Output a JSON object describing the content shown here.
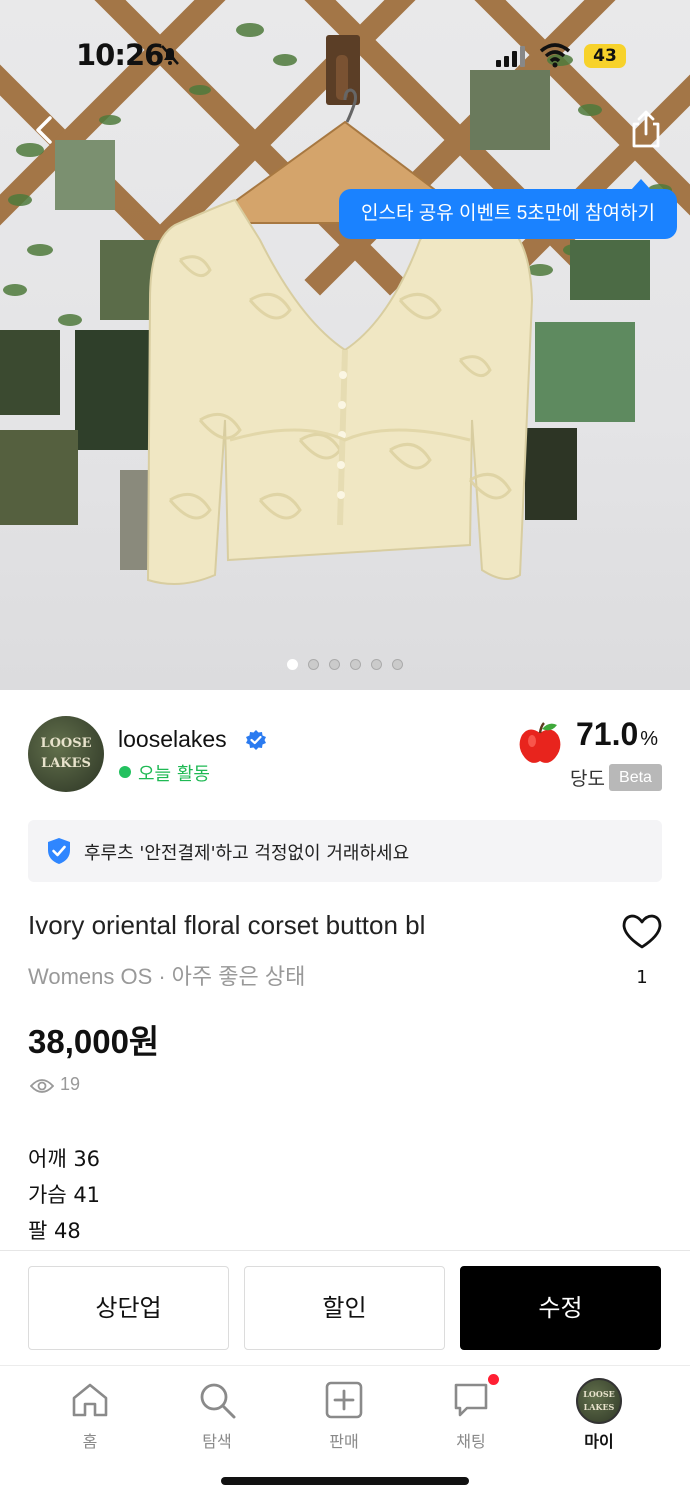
{
  "status_bar": {
    "time": "10:26",
    "battery": "43"
  },
  "hero": {
    "insta_event": "인스타 공유 이벤트 5초만에 참여하기",
    "image_count": 6,
    "active_index": 0
  },
  "seller": {
    "avatar_text_1": "LOOSE",
    "avatar_text_2": "LAKES",
    "name": "looselakes",
    "activity": "오늘 활동",
    "score": "71.0",
    "score_unit": "%",
    "score_label": "당도",
    "beta": "Beta"
  },
  "safety_banner": "후루츠 '안전결제'하고 걱정없이 거래하세요",
  "product": {
    "title": "Ivory oriental floral corset button bl",
    "size": "Womens OS",
    "separator": "·",
    "condition": "아주 좋은 상태",
    "price": "38,000원",
    "views": "19",
    "likes": "1",
    "description": [
      "어깨 36",
      "가슴 41",
      "팔 48"
    ]
  },
  "actions": {
    "bump": "상단업",
    "discount": "할인",
    "edit": "수정"
  },
  "tabs": [
    {
      "label": "홈",
      "icon": "home-icon"
    },
    {
      "label": "탐색",
      "icon": "search-icon"
    },
    {
      "label": "판매",
      "icon": "add-square-icon"
    },
    {
      "label": "채팅",
      "icon": "chat-icon"
    },
    {
      "label": "마이",
      "icon": "profile-avatar"
    }
  ],
  "colors": {
    "accent_blue": "#1a82ff",
    "active_green": "#1fb954",
    "notification_red": "#ff1f33",
    "primary_button": "#000000"
  }
}
